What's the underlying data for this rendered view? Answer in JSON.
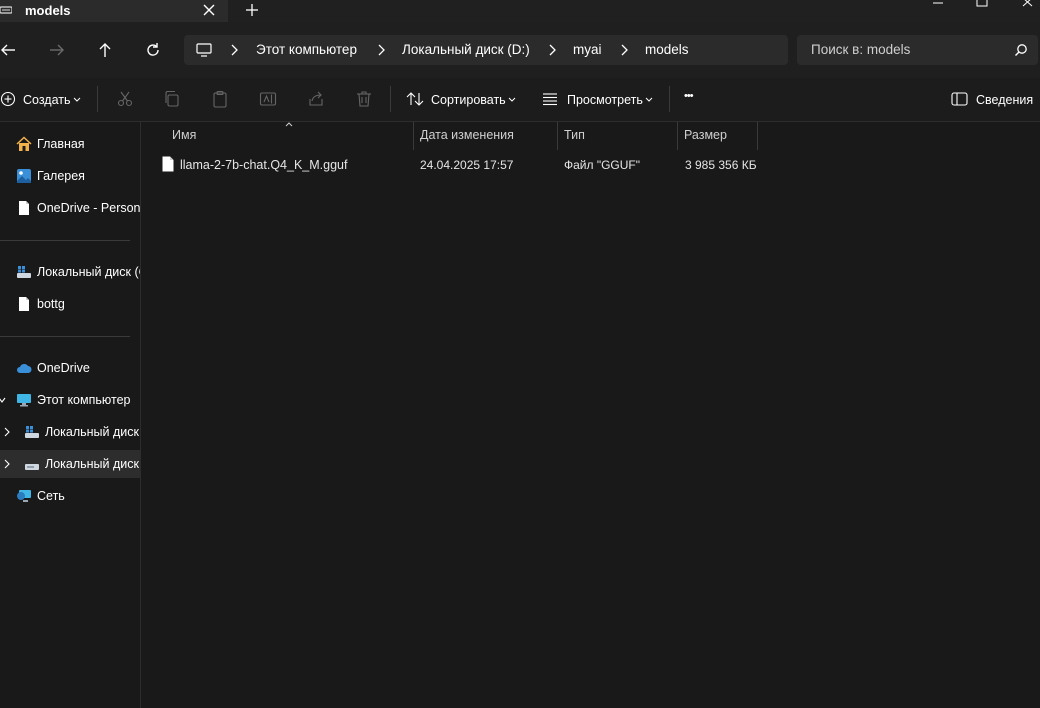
{
  "tab": {
    "title": "models",
    "new_tab": "+"
  },
  "breadcrumb": {
    "items": [
      "Этот компьютер",
      "Локальный диск (D:)",
      "myai",
      "models"
    ]
  },
  "search": {
    "placeholder": "Поиск в: models"
  },
  "toolbar": {
    "create": "Создать",
    "sort": "Сортировать",
    "view": "Просмотреть",
    "more": "•••",
    "details": "Сведения"
  },
  "sidebar": {
    "items": [
      {
        "label": "Главная",
        "icon": "home-icon"
      },
      {
        "label": "Галерея",
        "icon": "gallery-icon"
      },
      {
        "label": "OneDrive - Persona",
        "icon": "file-icon"
      },
      {
        "label": "Локальный диск (C",
        "icon": "drive-icon"
      },
      {
        "label": "bottg",
        "icon": "file-icon"
      },
      {
        "label": "OneDrive",
        "icon": "cloud-icon"
      },
      {
        "label": "Этот компьютер",
        "icon": "computer-icon"
      },
      {
        "label": "Локальный диск",
        "icon": "drive-icon"
      },
      {
        "label": "Локальный диск",
        "icon": "drive-icon"
      },
      {
        "label": "Сеть",
        "icon": "network-icon"
      }
    ]
  },
  "columns": {
    "name": "Имя",
    "modified": "Дата изменения",
    "type": "Тип",
    "size": "Размер"
  },
  "files": [
    {
      "name": "llama-2-7b-chat.Q4_K_M.gguf",
      "modified": "24.04.2025 17:57",
      "type": "Файл \"GGUF\"",
      "size": "3 985 356 КБ"
    }
  ],
  "colors": {
    "background": "#191919",
    "toolbar": "#1c1c1c",
    "address_box": "#2b2b2b",
    "selected": "#2d2d2d",
    "text": "#ffffff"
  }
}
